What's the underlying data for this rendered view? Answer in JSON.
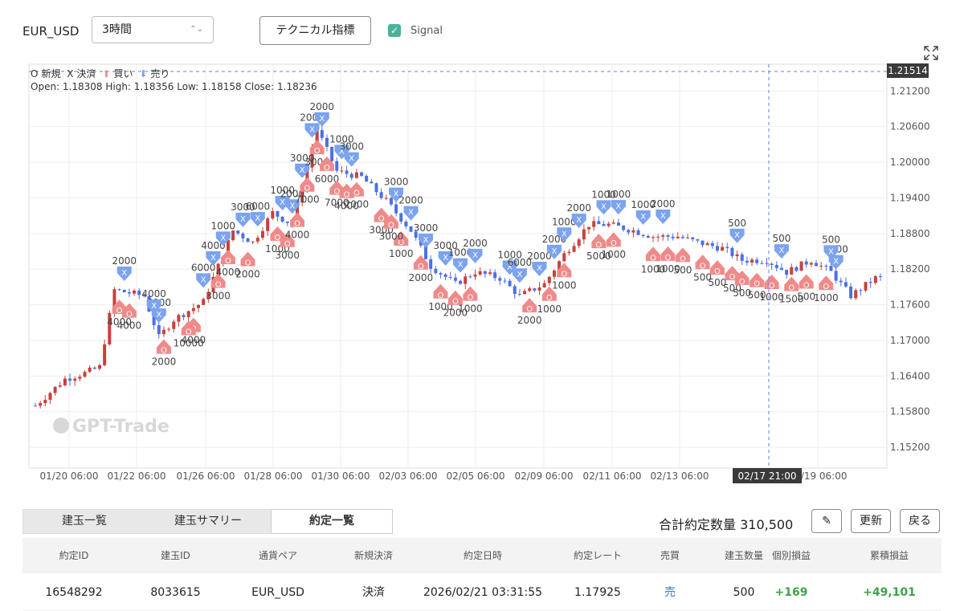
{
  "toolbar": {
    "pair": "EUR_USD",
    "timeframe": "3時間",
    "indicator_button": "テクニカル指標",
    "signal_label": "Signal",
    "signal_checked": true
  },
  "legend": {
    "new": "新規",
    "close": "決済",
    "buy": "買い",
    "sell": "売り",
    "new_marker": "O",
    "close_marker": "X"
  },
  "ohlc": "Open: 1.18308  High: 1.18356  Low: 1.18158  Close: 1.18236",
  "chart": {
    "watermark": "GPT-Trade",
    "current_price": "1.21514",
    "crosshair_time": "02/17 21:00",
    "colors": {
      "up": "#c8413c",
      "down": "#4d6fe6",
      "buy": "#f08a8a",
      "sell": "#7ba3f0",
      "crosshair": "#5b7fe0",
      "price_tag": "#3a3a3a"
    }
  },
  "chart_data": {
    "type": "candlestick",
    "y_ticks": [
      "1.21200",
      "1.20600",
      "1.20000",
      "1.19400",
      "1.18800",
      "1.18200",
      "1.17600",
      "1.17000",
      "1.16400",
      "1.15800",
      "1.15200"
    ],
    "x_ticks": [
      "01/20 06:00",
      "01/22 06:00",
      "01/26 06:00",
      "01/28 06:00",
      "01/30 06:00",
      "02/03 06:00",
      "02/05 06:00",
      "02/09 06:00",
      "02/11 06:00",
      "02/13 06:00",
      "02/17 21:00",
      "02/19 06:00"
    ],
    "ylim": [
      1.1485,
      1.2165
    ],
    "path": [
      [
        0,
        1.159
      ],
      [
        6,
        1.1635
      ],
      [
        10,
        1.1645
      ],
      [
        13,
        1.1655
      ],
      [
        16,
        1.1785
      ],
      [
        22,
        1.1775
      ],
      [
        25,
        1.1705
      ],
      [
        28,
        1.1735
      ],
      [
        34,
        1.1765
      ],
      [
        40,
        1.1885
      ],
      [
        44,
        1.1865
      ],
      [
        48,
        1.1915
      ],
      [
        52,
        1.1895
      ],
      [
        57,
        1.2055
      ],
      [
        61,
        1.1985
      ],
      [
        66,
        1.1975
      ],
      [
        71,
        1.1935
      ],
      [
        76,
        1.1885
      ],
      [
        80,
        1.1825
      ],
      [
        85,
        1.1795
      ],
      [
        89,
        1.1815
      ],
      [
        94,
        1.1805
      ],
      [
        98,
        1.1775
      ],
      [
        103,
        1.1795
      ],
      [
        107,
        1.1845
      ],
      [
        112,
        1.1895
      ],
      [
        116,
        1.1895
      ],
      [
        121,
        1.1885
      ],
      [
        125,
        1.1875
      ],
      [
        130,
        1.1875
      ],
      [
        134,
        1.1865
      ],
      [
        139,
        1.1855
      ],
      [
        143,
        1.1835
      ],
      [
        148,
        1.1835
      ],
      [
        152,
        1.1815
      ],
      [
        157,
        1.1835
      ],
      [
        161,
        1.1815
      ],
      [
        165,
        1.1775
      ],
      [
        170,
        1.1805
      ]
    ],
    "trade_markers": [
      {
        "side": "sell",
        "kind": "close",
        "label": "2000",
        "i": 18
      },
      {
        "side": "buy",
        "kind": "new",
        "label": "4000",
        "i": 17
      },
      {
        "side": "buy",
        "kind": "new",
        "label": "4000",
        "i": 19
      },
      {
        "side": "sell",
        "kind": "close",
        "label": "6000",
        "i": 25
      },
      {
        "side": "sell",
        "kind": "close",
        "label": "4000",
        "i": 24
      },
      {
        "side": "buy",
        "kind": "new",
        "label": "2000",
        "i": 26
      },
      {
        "side": "buy",
        "kind": "new",
        "label": "4000",
        "i": 32
      },
      {
        "side": "buy",
        "kind": "new",
        "label": "10000",
        "i": 31
      },
      {
        "side": "sell",
        "kind": "close",
        "label": "6000",
        "i": 34
      },
      {
        "side": "sell",
        "kind": "close",
        "label": "4000",
        "i": 36
      },
      {
        "side": "sell",
        "kind": "close",
        "label": "1000",
        "i": 38
      },
      {
        "side": "buy",
        "kind": "new",
        "label": "3000",
        "i": 37
      },
      {
        "side": "buy",
        "kind": "new",
        "label": "4000",
        "i": 39
      },
      {
        "side": "sell",
        "kind": "close",
        "label": "3000",
        "i": 42
      },
      {
        "side": "sell",
        "kind": "close",
        "label": "6000",
        "i": 45
      },
      {
        "side": "buy",
        "kind": "new",
        "label": "2000",
        "i": 43
      },
      {
        "side": "sell",
        "kind": "close",
        "label": "1000",
        "i": 50
      },
      {
        "side": "sell",
        "kind": "close",
        "label": "2000",
        "i": 52
      },
      {
        "side": "sell",
        "kind": "close",
        "label": "3000",
        "i": 54
      },
      {
        "side": "sell",
        "kind": "close",
        "label": "2000",
        "i": 56
      },
      {
        "side": "sell",
        "kind": "close",
        "label": "2000",
        "i": 58
      },
      {
        "side": "buy",
        "kind": "new",
        "label": "1000",
        "i": 49
      },
      {
        "side": "buy",
        "kind": "new",
        "label": "3000",
        "i": 51
      },
      {
        "side": "buy",
        "kind": "new",
        "label": "4000",
        "i": 53
      },
      {
        "side": "buy",
        "kind": "new",
        "label": "7000",
        "i": 55
      },
      {
        "side": "buy",
        "kind": "new",
        "label": "3000",
        "i": 57
      },
      {
        "side": "buy",
        "kind": "new",
        "label": "6000",
        "i": 59
      },
      {
        "side": "sell",
        "kind": "close",
        "label": "1000",
        "i": 62
      },
      {
        "side": "sell",
        "kind": "close",
        "label": "3000",
        "i": 64
      },
      {
        "side": "buy",
        "kind": "new",
        "label": "7000",
        "i": 61
      },
      {
        "side": "buy",
        "kind": "new",
        "label": "4000",
        "i": 63
      },
      {
        "side": "buy",
        "kind": "new",
        "label": "2000",
        "i": 65
      },
      {
        "side": "sell",
        "kind": "close",
        "label": "3000",
        "i": 73
      },
      {
        "side": "sell",
        "kind": "close",
        "label": "2000",
        "i": 76
      },
      {
        "side": "sell",
        "kind": "close",
        "label": "3000",
        "i": 79
      },
      {
        "side": "buy",
        "kind": "new",
        "label": "3000",
        "i": 70
      },
      {
        "side": "buy",
        "kind": "new",
        "label": "1000",
        "i": 74
      },
      {
        "side": "buy",
        "kind": "new",
        "label": "3000",
        "i": 72
      },
      {
        "side": "buy",
        "kind": "new",
        "label": "2000",
        "i": 78
      },
      {
        "side": "sell",
        "kind": "close",
        "label": "3000",
        "i": 83
      },
      {
        "side": "sell",
        "kind": "close",
        "label": "1000",
        "i": 86
      },
      {
        "side": "sell",
        "kind": "close",
        "label": "2000",
        "i": 89
      },
      {
        "side": "buy",
        "kind": "new",
        "label": "1000",
        "i": 82
      },
      {
        "side": "buy",
        "kind": "new",
        "label": "2000",
        "i": 85
      },
      {
        "side": "buy",
        "kind": "new",
        "label": "1000",
        "i": 88
      },
      {
        "side": "sell",
        "kind": "close",
        "label": "1000",
        "i": 96
      },
      {
        "side": "sell",
        "kind": "close",
        "label": "6000",
        "i": 98
      },
      {
        "side": "sell",
        "kind": "close",
        "label": "2000",
        "i": 102
      },
      {
        "side": "sell",
        "kind": "close",
        "label": "2000",
        "i": 105
      },
      {
        "side": "sell",
        "kind": "close",
        "label": "1000",
        "i": 107
      },
      {
        "side": "sell",
        "kind": "close",
        "label": "2000",
        "i": 110
      },
      {
        "side": "sell",
        "kind": "close",
        "label": "1000",
        "i": 115
      },
      {
        "side": "sell",
        "kind": "close",
        "label": "1000",
        "i": 118
      },
      {
        "side": "buy",
        "kind": "new",
        "label": "2000",
        "i": 100
      },
      {
        "side": "buy",
        "kind": "new",
        "label": "1000",
        "i": 104
      },
      {
        "side": "buy",
        "kind": "new",
        "label": "1000",
        "i": 107
      },
      {
        "side": "buy",
        "kind": "new",
        "label": "5000",
        "i": 114
      },
      {
        "side": "buy",
        "kind": "new",
        "label": "1000",
        "i": 117
      },
      {
        "side": "sell",
        "kind": "close",
        "label": "1000",
        "i": 123
      },
      {
        "side": "sell",
        "kind": "close",
        "label": "2000",
        "i": 127
      },
      {
        "side": "buy",
        "kind": "new",
        "label": "1000",
        "i": 125
      },
      {
        "side": "buy",
        "kind": "new",
        "label": "1000",
        "i": 128
      },
      {
        "side": "buy",
        "kind": "new",
        "label": "500",
        "i": 131
      },
      {
        "side": "buy",
        "kind": "new",
        "label": "500",
        "i": 135
      },
      {
        "side": "buy",
        "kind": "new",
        "label": "500",
        "i": 138
      },
      {
        "side": "sell",
        "kind": "close",
        "label": "500",
        "i": 142
      },
      {
        "side": "buy",
        "kind": "new",
        "label": "500",
        "i": 141
      },
      {
        "side": "buy",
        "kind": "new",
        "label": "500",
        "i": 143
      },
      {
        "side": "buy",
        "kind": "new",
        "label": "500",
        "i": 146
      },
      {
        "side": "buy",
        "kind": "new",
        "label": "1000",
        "i": 149
      },
      {
        "side": "sell",
        "kind": "close",
        "label": "500",
        "i": 151
      },
      {
        "side": "buy",
        "kind": "new",
        "label": "1500",
        "i": 153
      },
      {
        "side": "buy",
        "kind": "new",
        "label": "500",
        "i": 156
      },
      {
        "side": "buy",
        "kind": "new",
        "label": "1000",
        "i": 160
      },
      {
        "side": "sell",
        "kind": "close",
        "label": "1500",
        "i": 162
      },
      {
        "side": "sell",
        "kind": "close",
        "label": "500",
        "i": 161
      }
    ]
  },
  "bottom": {
    "tabs": [
      "建玉一覧",
      "建玉サマリー",
      "約定一覧"
    ],
    "active_tab": 2,
    "total_label": "合計約定数量",
    "total_value": "310,500",
    "refresh": "更新",
    "back": "戻る"
  },
  "table": {
    "headers": [
      "約定ID",
      "建玉ID",
      "通貨ペア",
      "新規決済",
      "約定日時",
      "約定レート",
      "売買",
      "建玉数量",
      "個別損益",
      "累積損益"
    ],
    "rows": [
      [
        "16548292",
        "8033615",
        "EUR_USD",
        "決済",
        "2026/02/21 03:31:55",
        "1.17925",
        "売",
        "500",
        "+169",
        "+49,101"
      ]
    ]
  }
}
